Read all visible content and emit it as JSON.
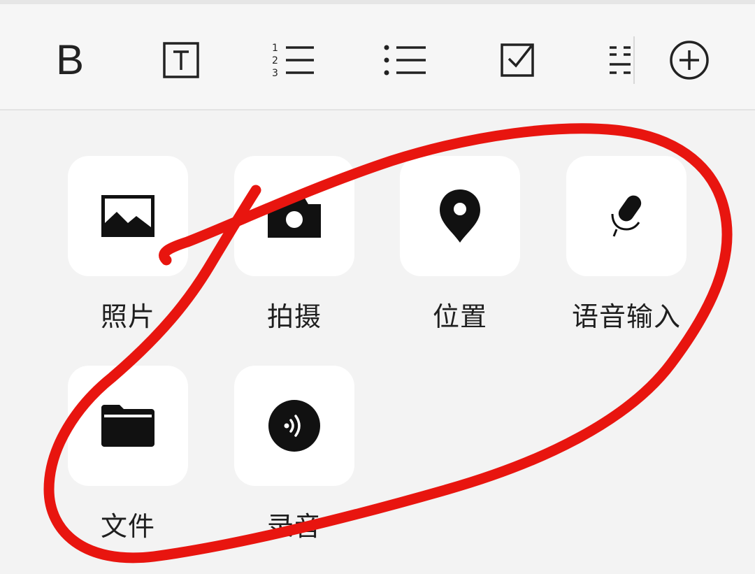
{
  "toolbar": {
    "bold_label": "B",
    "tools": [
      {
        "icon": "bold-icon"
      },
      {
        "icon": "text-style-icon"
      },
      {
        "icon": "numbered-list-icon"
      },
      {
        "icon": "bulleted-list-icon"
      },
      {
        "icon": "checkbox-icon"
      },
      {
        "icon": "divider-icon"
      },
      {
        "icon": "add-circle-icon"
      }
    ]
  },
  "attachments": [
    {
      "label": "照片",
      "icon": "image-icon"
    },
    {
      "label": "拍摄",
      "icon": "camera-icon"
    },
    {
      "label": "位置",
      "icon": "location-pin-icon"
    },
    {
      "label": "语音输入",
      "icon": "microphone-icon"
    },
    {
      "label": "文件",
      "icon": "folder-icon"
    },
    {
      "label": "录音",
      "icon": "audio-record-icon"
    }
  ],
  "annotation": {
    "color": "#e8150f",
    "kind": "hand-drawn circle"
  },
  "colors": {
    "icon": "#111111",
    "tile": "#ffffff",
    "panel": "#f3f3f3"
  }
}
